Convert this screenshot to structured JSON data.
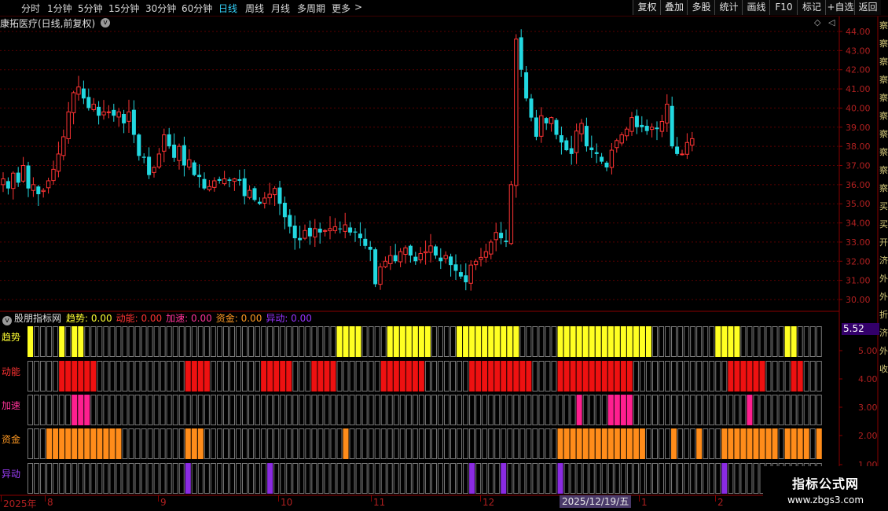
{
  "toolbar": {
    "periods": [
      {
        "label": "分时"
      },
      {
        "label": "1分钟"
      },
      {
        "label": "5分钟"
      },
      {
        "label": "15分钟"
      },
      {
        "label": "30分钟"
      },
      {
        "label": "60分钟"
      },
      {
        "label": "日线",
        "active": true
      },
      {
        "label": "周线"
      },
      {
        "label": "月线"
      },
      {
        "label": "多周期"
      },
      {
        "label": "更多"
      }
    ],
    "more_chevron": ">",
    "right_buttons": [
      "复权",
      "叠加",
      "多股",
      "统计",
      "画线",
      "F10",
      "标记",
      "+自选",
      "返回"
    ]
  },
  "stock": {
    "title": "康拓医疗(日线,前复权)",
    "dropdown_glyph": "v",
    "diamond_glyph": "◇",
    "collapse_glyph": "◁"
  },
  "price_axis": {
    "labels": [
      "44.00",
      "43.00",
      "42.00",
      "41.00",
      "40.00",
      "39.00",
      "38.00",
      "37.00",
      "36.00",
      "35.00",
      "34.00",
      "33.00",
      "32.00",
      "31.00",
      "30.00"
    ]
  },
  "indicator": {
    "name": "股朋指标网",
    "items": [
      {
        "label": "趋势:",
        "value": "0.00",
        "color": "#ffff33"
      },
      {
        "label": "动能:",
        "value": "0.00",
        "color": "#ff3333"
      },
      {
        "label": "加速:",
        "value": "0.00",
        "color": "#ff3399"
      },
      {
        "label": "资金:",
        "value": "0.00",
        "color": "#ff9922"
      },
      {
        "label": "异动:",
        "value": "0.00",
        "color": "#9933ff"
      }
    ],
    "rows": [
      {
        "label": "趋势",
        "color": "#ffff22",
        "label_color": "#ffff33"
      },
      {
        "label": "动能",
        "color": "#ee1111",
        "label_color": "#ff3333"
      },
      {
        "label": "加速",
        "color": "#ff1f8f",
        "label_color": "#ff3399"
      },
      {
        "label": "资金",
        "color": "#ff8c1a",
        "label_color": "#ff9922"
      },
      {
        "label": "异动",
        "color": "#8a2be2",
        "label_color": "#a040ff"
      }
    ],
    "axis_labels": [
      "5.00",
      "4.00",
      "3.00",
      "2.00",
      "1.00"
    ],
    "current_value": "5.52"
  },
  "date_axis": {
    "labels": [
      {
        "text": "2025年"
      },
      {
        "text": "8"
      },
      {
        "text": "9"
      },
      {
        "text": "10"
      },
      {
        "text": "11"
      },
      {
        "text": "12"
      },
      {
        "text": "1"
      },
      {
        "text": "2"
      }
    ],
    "cursor_date": "2025/12/19/五"
  },
  "right_strip_text": "察察察察察察察察察察买买开济外外折济外收",
  "watermark": {
    "title": "指标公式网",
    "url": "www.zbgs3.com"
  },
  "colors": {
    "up": "#ff3333",
    "down": "#22d8e0",
    "grid": "#5a0000",
    "frame": "#8a0000"
  },
  "chart_data": {
    "type": "candlestick",
    "title": "康拓医疗(日线,前复权)",
    "ylim": [
      29.6,
      44.5
    ],
    "y_ticks": [
      30,
      31,
      32,
      33,
      34,
      35,
      36,
      37,
      38,
      39,
      40,
      41,
      42,
      43,
      44
    ],
    "x_labels": [
      "2025年",
      "8",
      "9",
      "10",
      "11",
      "12",
      "2025/12/19/五",
      "1",
      "2"
    ],
    "close_sequence": [
      36.3,
      35.8,
      36.6,
      36.1,
      37.0,
      35.8,
      36.0,
      35.5,
      35.7,
      36.2,
      36.8,
      37.6,
      38.5,
      39.8,
      40.8,
      41.1,
      40.5,
      40.0,
      40.2,
      39.6,
      39.8,
      39.8,
      39.6,
      39.8,
      39.2,
      39.8,
      38.6,
      37.5,
      37.4,
      36.5,
      36.9,
      37.6,
      38.6,
      38.0,
      37.4,
      38.0,
      37.0,
      37.3,
      36.5,
      36.4,
      35.8,
      35.9,
      36.2,
      36.2,
      36.3,
      36.2,
      36.3,
      36.2,
      35.4,
      35.7,
      35.2,
      35.0,
      35.3,
      35.5,
      35.8,
      35.0,
      34.3,
      33.8,
      33.2,
      33.1,
      33.6,
      33.3,
      33.7,
      33.5,
      33.6,
      33.7,
      33.8,
      33.7,
      33.9,
      33.5,
      33.5,
      33.2,
      32.8,
      32.6,
      30.8,
      31.7,
      32.0,
      32.3,
      32.0,
      32.5,
      32.7,
      32.3,
      32.0,
      32.4,
      32.5,
      32.8,
      32.3,
      32.0,
      32.3,
      31.8,
      31.5,
      31.2,
      30.9,
      31.8,
      32.0,
      32.2,
      32.5,
      33.0,
      33.5,
      33.2,
      33.0,
      36.0,
      43.6,
      42.0,
      40.5,
      39.5,
      38.5,
      39.6,
      39.2,
      39.5,
      38.6,
      38.2,
      37.8,
      37.6,
      38.8,
      39.2,
      38.0,
      37.8,
      37.6,
      37.2,
      36.9,
      37.8,
      38.3,
      38.6,
      38.9,
      39.5,
      39.0,
      39.0,
      38.8,
      39.0,
      38.9,
      39.3,
      40.2,
      38.0,
      37.6,
      37.6,
      38.2,
      38.4
    ]
  }
}
